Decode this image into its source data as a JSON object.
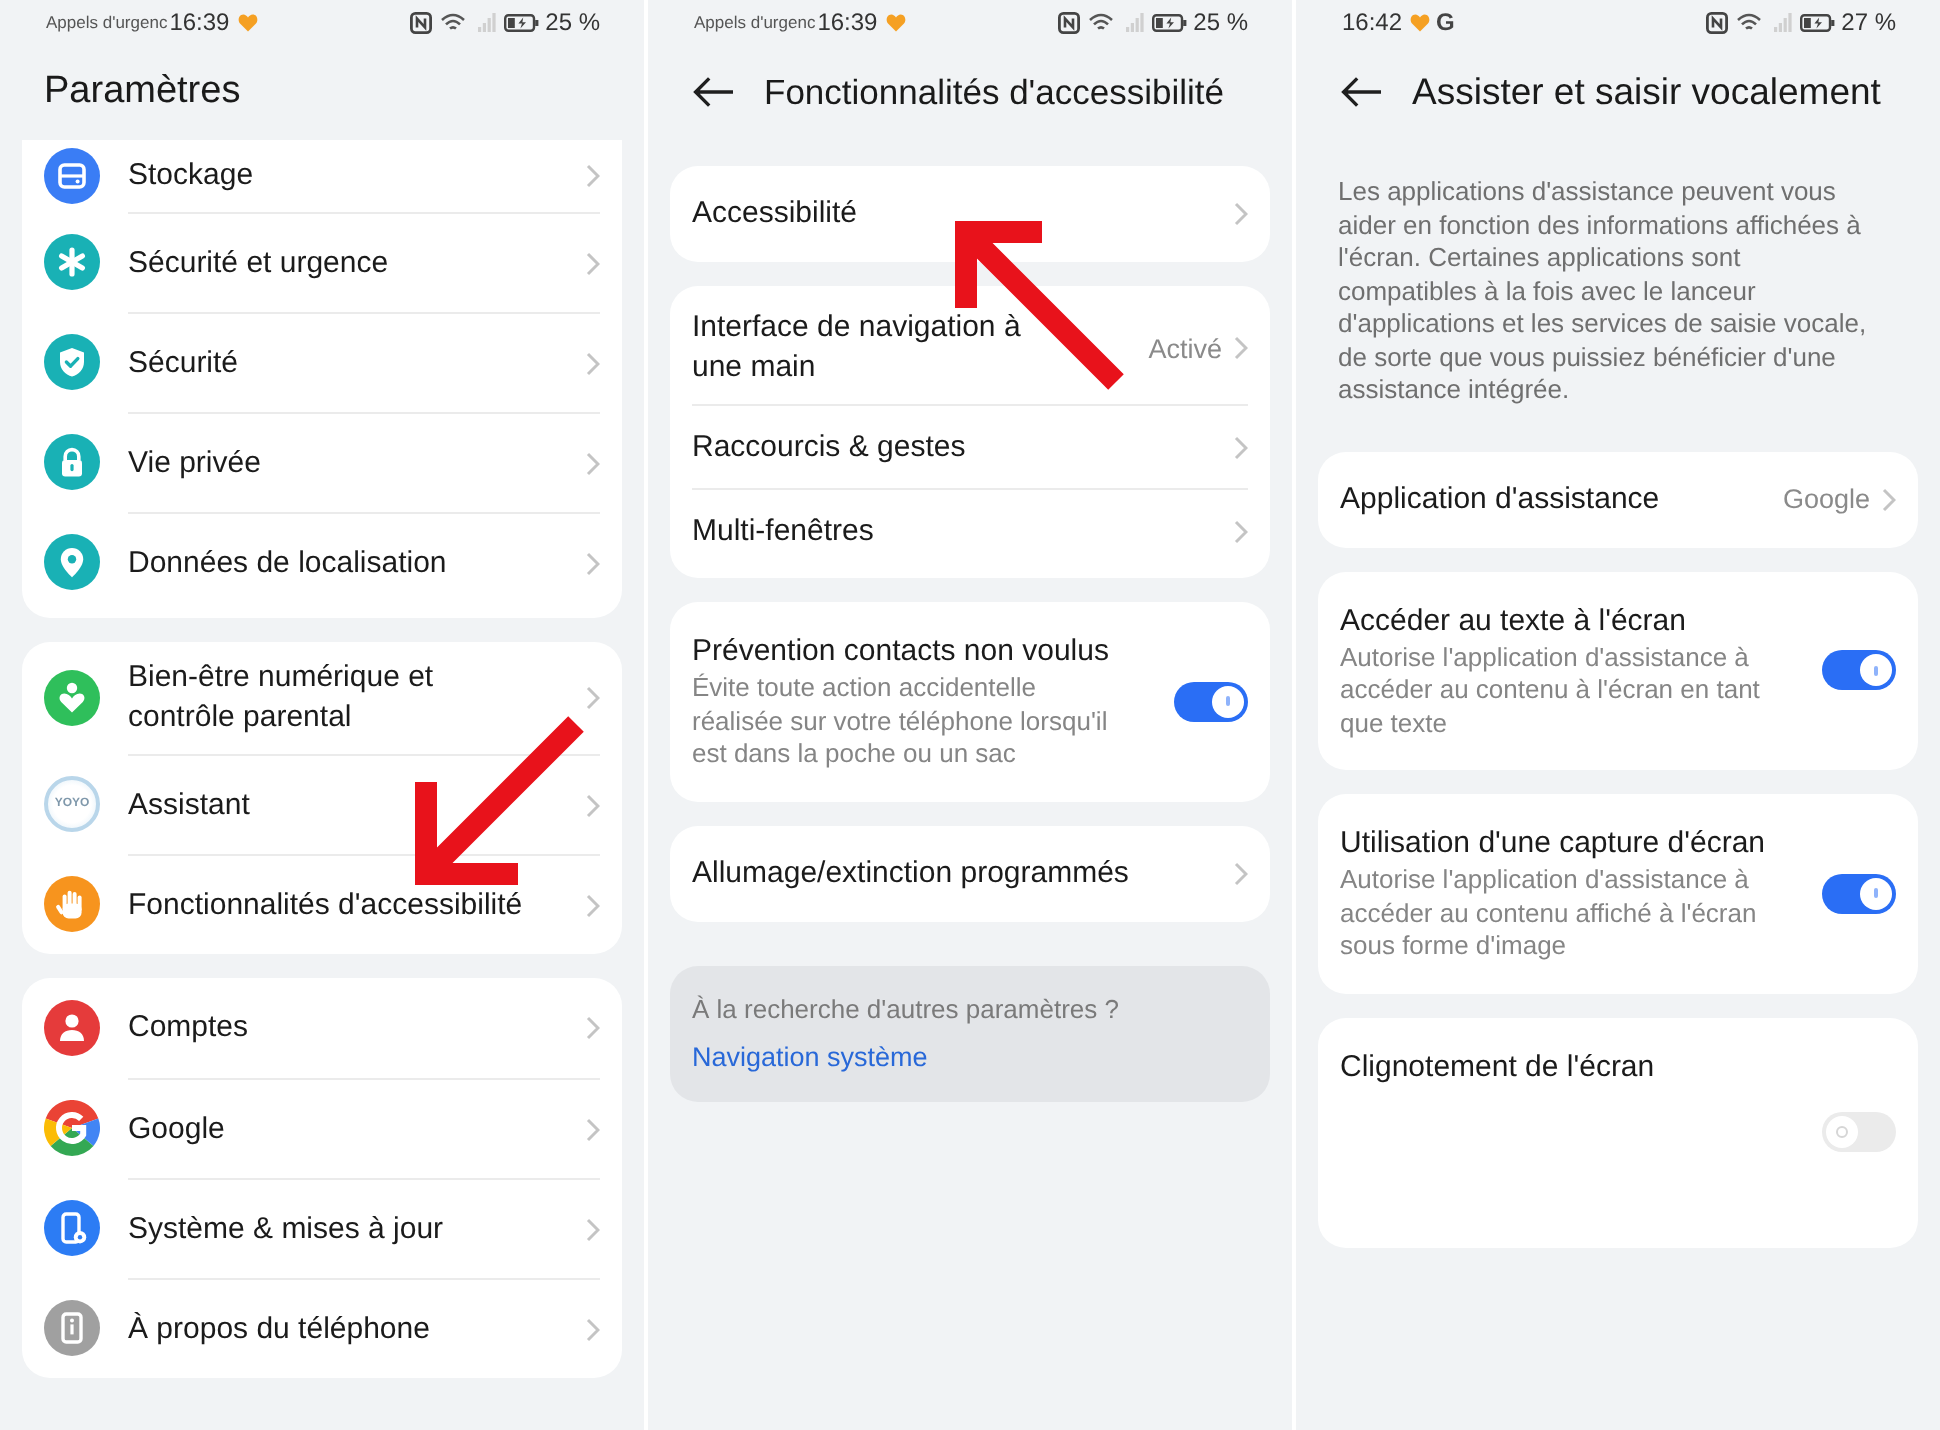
{
  "settings_screen": {
    "status_bar": {
      "carrier_text": "Appels d'urgenc",
      "time": "16:39",
      "battery": "25 %"
    },
    "title": "Paramètres",
    "groups": [
      {
        "items": [
          {
            "label": "Stockage"
          },
          {
            "label": "Sécurité et urgence"
          },
          {
            "label": "Sécurité"
          },
          {
            "label": "Vie privée"
          },
          {
            "label": "Données de localisation"
          }
        ]
      },
      {
        "items": [
          {
            "label": "Bien-être numérique et contrôle parental"
          },
          {
            "label": "Assistant",
            "logo_text": "YOYO"
          },
          {
            "label": "Fonctionnalités d'accessibilité"
          }
        ]
      },
      {
        "items": [
          {
            "label": "Comptes"
          },
          {
            "label": "Google"
          },
          {
            "label": "Système & mises à jour"
          },
          {
            "label": "À propos du téléphone"
          }
        ]
      }
    ]
  },
  "accessibility_screen": {
    "status_bar": {
      "carrier_text": "Appels d'urgenc",
      "time": "16:39",
      "battery": "25 %"
    },
    "title": "Fonctionnalités d'accessibilité",
    "groups": [
      {
        "items": [
          {
            "kind": "link",
            "label": "Accessibilité"
          }
        ]
      },
      {
        "items": [
          {
            "kind": "link",
            "label": "Interface de navigation à une main",
            "value": "Activé"
          },
          {
            "kind": "link",
            "label": "Raccourcis & gestes"
          },
          {
            "kind": "link",
            "label": "Multi-fenêtres"
          }
        ]
      },
      {
        "items": [
          {
            "kind": "toggle",
            "label": "Prévention contacts non voulus",
            "description": "Évite toute action accidentelle réalisée sur votre téléphone lorsqu'il est dans la poche ou un sac",
            "on": true,
            "disabled": false
          }
        ]
      },
      {
        "items": [
          {
            "kind": "link",
            "label": "Allumage/extinction programmés"
          }
        ]
      }
    ],
    "suggestion": {
      "text": "À la recherche d'autres paramètres ?",
      "link": "Navigation système"
    }
  },
  "assistant_screen": {
    "status_bar": {
      "time": "16:42",
      "app_badge": "G",
      "battery": "27 %"
    },
    "title": "Assister et saisir vocalement",
    "intro": "Les applications d'assistance peuvent vous aider en fonction des informations affichées à l'écran. Certaines applications sont compatibles à la fois avec le lanceur d'applications et les services de saisie vocale, de sorte que vous puissiez bénéficier d'une assistance intégrée.",
    "groups": [
      {
        "items": [
          {
            "kind": "link",
            "label": "Application d'assistance",
            "value": "Google"
          }
        ]
      },
      {
        "items": [
          {
            "kind": "toggle",
            "label": "Accéder au texte à l'écran",
            "description": "Autorise l'application d'assistance à accéder au contenu à l'écran en tant que texte",
            "on": true,
            "disabled": false
          }
        ]
      },
      {
        "items": [
          {
            "kind": "toggle",
            "label": "Utilisation d'une capture d'écran",
            "description": "Autorise l'application d'assistance à accéder au contenu affiché à l'écran sous forme d'image",
            "on": true,
            "disabled": false
          }
        ]
      },
      {
        "items": [
          {
            "kind": "toggle",
            "label": "Clignotement de l'écran",
            "on": false,
            "disabled": true
          }
        ]
      }
    ]
  }
}
